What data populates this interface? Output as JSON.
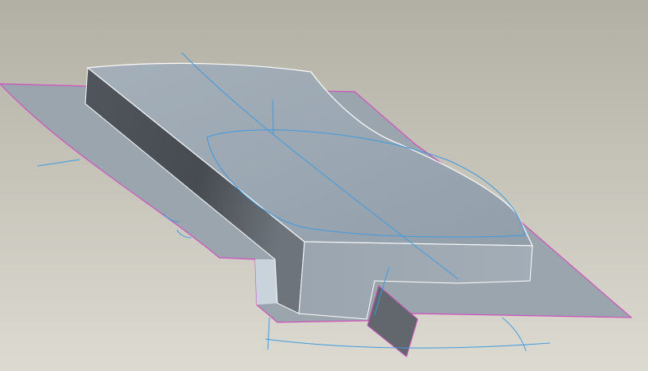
{
  "viewport": {
    "colors": {
      "background_top": "#b2b0a4",
      "background_bottom": "#dddbd1",
      "sheet_fill": "#9ba5ae",
      "sheet_edge": "#d050c0",
      "top_face": "#9daab4",
      "side_dark": "#4d5359",
      "side_light": "#727a82",
      "front_face": "#9ca7b1",
      "plate": "#62676d",
      "datum_curve": "#3d9ae0",
      "edge_highlight": "#ffffff"
    }
  }
}
